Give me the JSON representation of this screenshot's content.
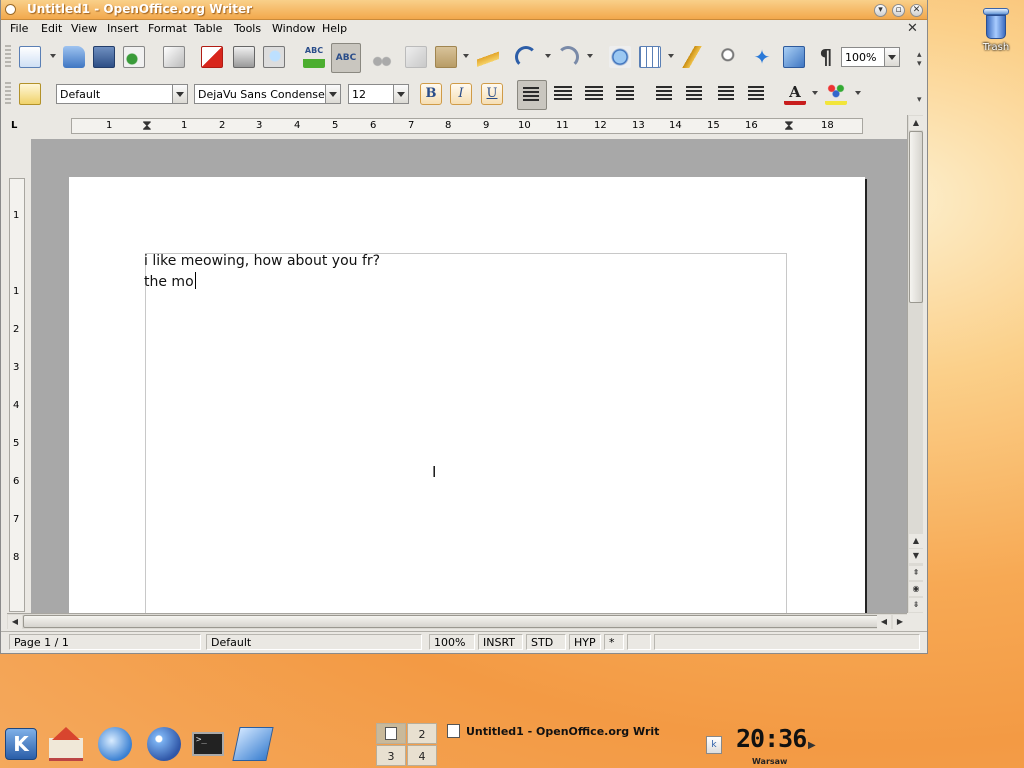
{
  "desktop": {
    "trash_label": "Trash"
  },
  "window": {
    "title": "Untitled1 - OpenOffice.org Writer"
  },
  "menu": [
    "File",
    "Edit",
    "View",
    "Insert",
    "Format",
    "Table",
    "Tools",
    "Window",
    "Help"
  ],
  "toolbar": {
    "zoom": "100%",
    "icons": [
      "new-icon",
      "open-icon",
      "save-icon",
      "send-icon",
      "edit-file-icon",
      "export-pdf-icon",
      "print-icon",
      "page-preview-icon",
      "spellcheck-icon",
      "autospellcheck-icon",
      "cut-icon",
      "copy-icon",
      "paste-icon",
      "clone-format-icon",
      "undo-icon",
      "redo-icon",
      "hyperlink-icon",
      "table-icon",
      "draw-icon",
      "find-replace-icon",
      "navigator-icon",
      "gallery-icon",
      "nonprinting-chars-icon"
    ],
    "spell_label": "ABC"
  },
  "format": {
    "style": "Default",
    "font": "DejaVu Sans Condensed",
    "size": "12",
    "bold": "B",
    "italic": "I",
    "underline": "U"
  },
  "ruler": {
    "h": [
      "1",
      "1",
      "2",
      "3",
      "4",
      "5",
      "6",
      "7",
      "8",
      "9",
      "10",
      "11",
      "12",
      "13",
      "14",
      "15",
      "16",
      "17",
      "18"
    ],
    "v": [
      "1",
      "1",
      "2",
      "3",
      "4",
      "5",
      "6",
      "7",
      "8"
    ]
  },
  "document": {
    "paragraphs": [
      "i like meowing, how about you fr?",
      "the mo"
    ]
  },
  "status": {
    "page": "Page 1 / 1",
    "style": "Default",
    "zoom": "100%",
    "insert": "INSRT",
    "selection": "STD",
    "hyperlink": "HYP",
    "modified": "*"
  },
  "taskbar": {
    "desktops": [
      "1",
      "2",
      "3",
      "4"
    ],
    "task": "Untitled1 - OpenOffice.org Writ",
    "clock": "20:36",
    "timezone": "Warsaw"
  },
  "colors": {
    "titlebar": "#f2a84c",
    "desktop": "#f7a954",
    "button_accent": "#d09b47"
  }
}
